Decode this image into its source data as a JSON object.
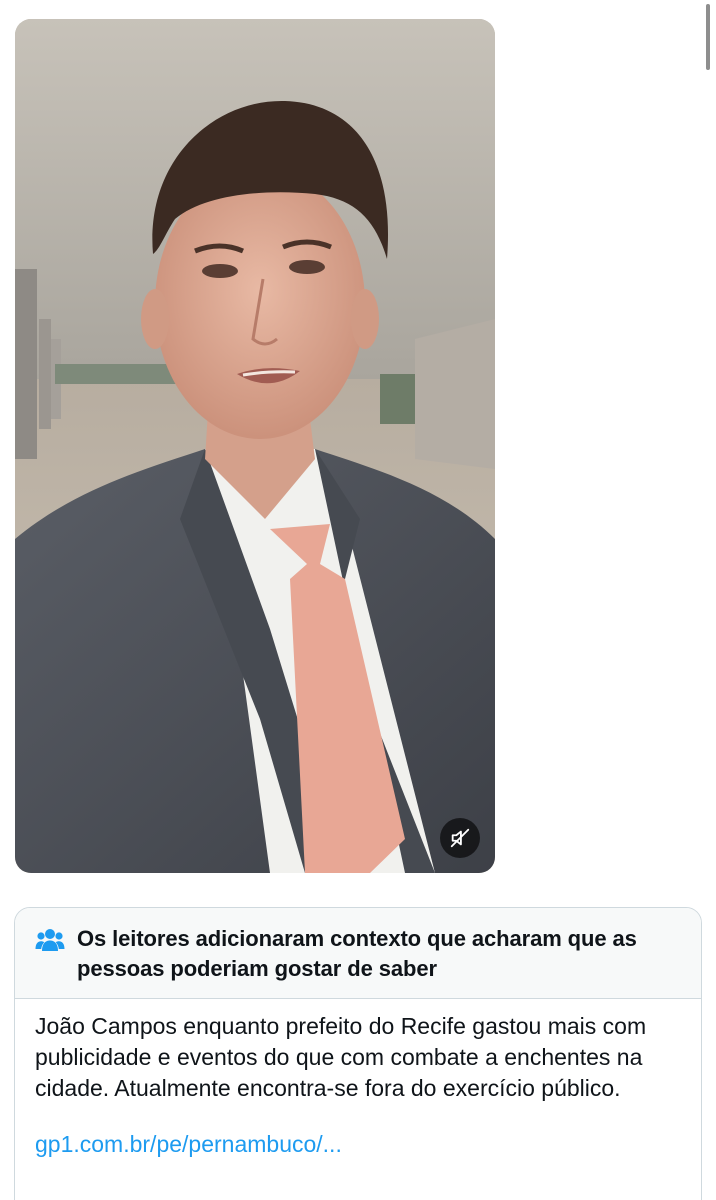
{
  "video": {
    "mute_icon": "muted-speaker-icon",
    "colors": {
      "suit": "#4f535a",
      "tie": "#e8a795",
      "shirt": "#f1f1ee",
      "background": "#b9b2a6"
    }
  },
  "note": {
    "icon": "people-icon",
    "header_text": "Os leitores adicionaram contexto que acharam que as pessoas poderiam gostar de saber",
    "body_text": "João Campos enquanto prefeito do Recife gastou mais com publicidade e eventos do que com combate a enchentes na cidade. Atualmente encontra-se fora do exercício público.",
    "link_text": "gp1.com.br/pe/pernambuco/...",
    "colors": {
      "icon": "#1d9bf0",
      "link": "#1d9bf0",
      "header_bg": "#f7f9f9",
      "border": "#cfd9de"
    }
  }
}
